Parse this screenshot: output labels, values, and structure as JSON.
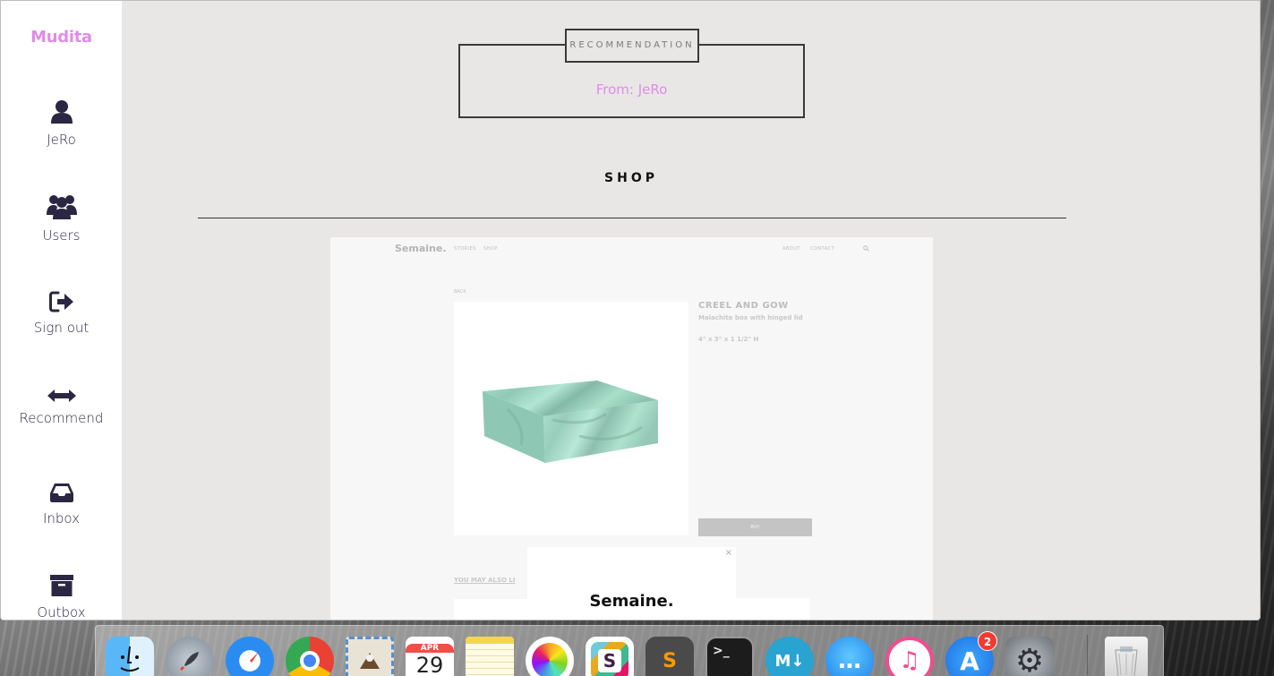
{
  "app": {
    "brand": "Mudita"
  },
  "sidebar": {
    "items": [
      {
        "label": "JeRo",
        "icon": "user-icon"
      },
      {
        "label": "Users",
        "icon": "users-icon"
      },
      {
        "label": "Sign out",
        "icon": "sign-out-icon"
      },
      {
        "label": "Recommend",
        "icon": "arrows-horizontal-icon"
      },
      {
        "label": "Inbox",
        "icon": "inbox-icon"
      },
      {
        "label": "Outbox",
        "icon": "archive-icon"
      }
    ]
  },
  "recommendation": {
    "tag": "RECOMMENDATION",
    "from": "From: JeRo"
  },
  "section": {
    "title": "SHOP"
  },
  "preview": {
    "logo": "Semaine.",
    "nav_left": [
      "STORIES",
      "SHOP"
    ],
    "nav_right": [
      "ABOUT",
      "CONTACT"
    ],
    "back": "BACK",
    "brand": "CREEL AND GOW",
    "description": "Malachite box with hinged lid",
    "dimensions": "4\" x 3\" x 1 1/2\" H",
    "buy": "BUY",
    "also_like": "YOU MAY ALSO LI",
    "popup_close": "×",
    "popup_logo": "Semaine."
  },
  "dock": {
    "apps": [
      {
        "name": "Finder",
        "icon": "finder-icon",
        "color": "#3d8fe6"
      },
      {
        "name": "Launchpad",
        "icon": "rocket-icon",
        "color": "#8e9aa6"
      },
      {
        "name": "Safari",
        "icon": "compass-icon",
        "color": "#2d8ef0"
      },
      {
        "name": "Chrome",
        "icon": "chrome-icon",
        "color": "#e94235"
      },
      {
        "name": "Mail",
        "icon": "stamp-icon",
        "color": "#5b8fc9"
      },
      {
        "name": "Calendar",
        "icon": "calendar-icon",
        "color": "#ffffff",
        "month": "APR",
        "day": "29"
      },
      {
        "name": "Notes",
        "icon": "notes-icon",
        "color": "#f8e27a"
      },
      {
        "name": "Photos",
        "icon": "photos-icon",
        "color": "#ffffff"
      },
      {
        "name": "Slack",
        "icon": "slack-icon",
        "color": "#6ecadc"
      },
      {
        "name": "Sublime Text",
        "icon": "sublime-icon",
        "color": "#4a4a4a",
        "glyph": "S"
      },
      {
        "name": "Terminal",
        "icon": "terminal-icon",
        "color": "#1c1c1c",
        "glyph": ">_"
      },
      {
        "name": "MacDown",
        "icon": "markdown-icon",
        "color": "#29a3d0",
        "glyph": "M↓"
      },
      {
        "name": "Messages",
        "icon": "messages-icon",
        "color": "#2ea5f5",
        "glyph": "…"
      },
      {
        "name": "iTunes",
        "icon": "music-icon",
        "color": "#f14d8e",
        "glyph": "♫"
      },
      {
        "name": "App Store",
        "icon": "app-store-icon",
        "color": "#1f8cf0",
        "glyph": "A",
        "badge": "2"
      },
      {
        "name": "System Preferences",
        "icon": "gear-icon",
        "color": "#7c8088",
        "glyph": "⚙"
      },
      {
        "name": "Trash",
        "icon": "trash-icon",
        "color": "#e3e3e3"
      }
    ]
  },
  "colors": {
    "accent": "#e08be9",
    "nav_icon": "#2b2743",
    "content_bg": "#e9e7e5",
    "malachite": "#9ed9c6"
  }
}
